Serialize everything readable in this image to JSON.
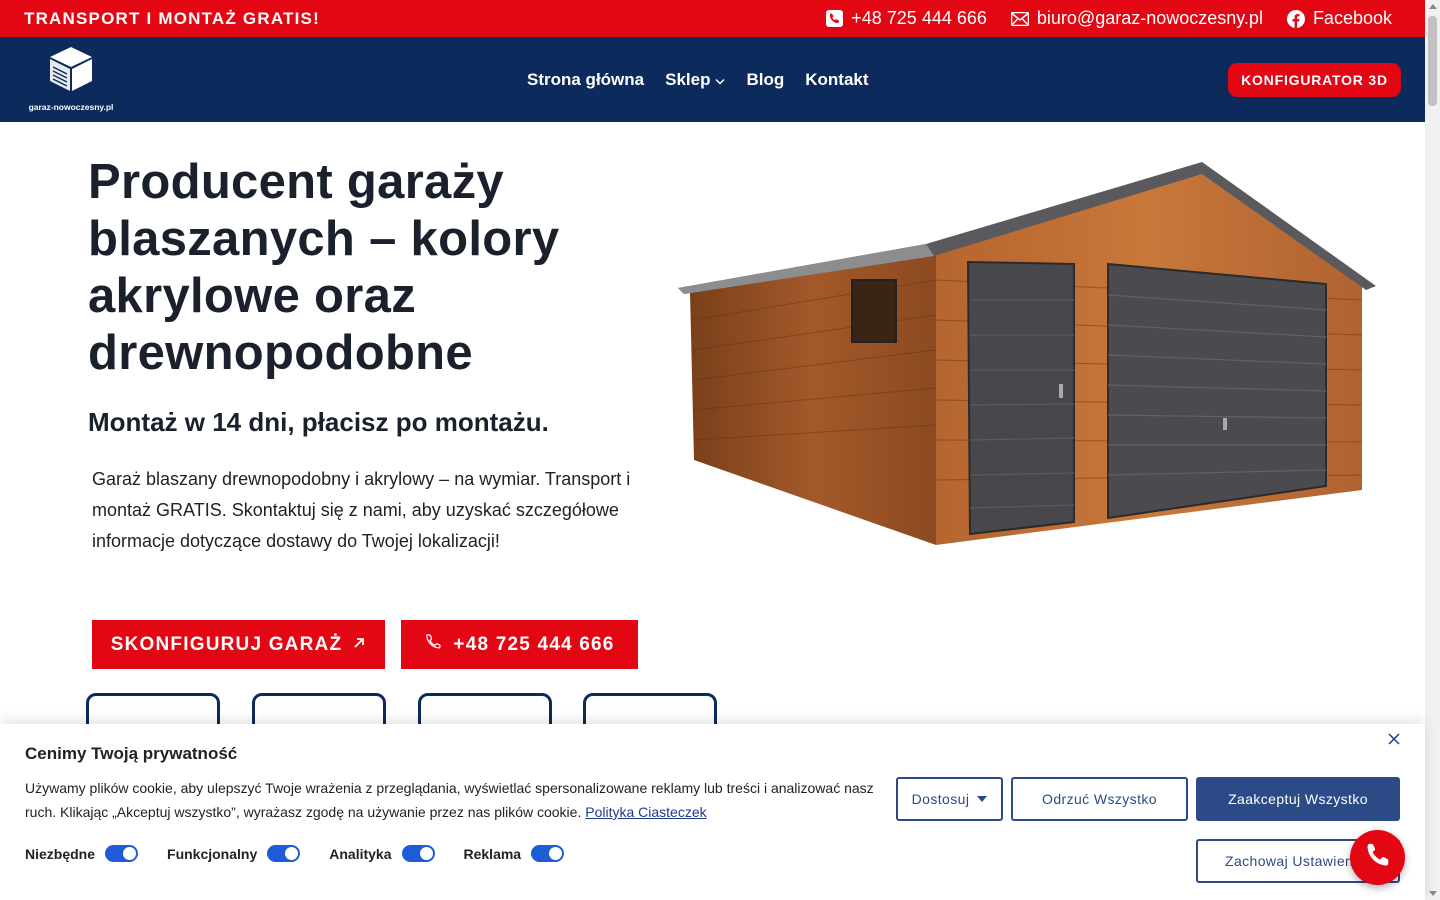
{
  "topbar": {
    "promo": "TRANSPORT I MONTAŻ GRATIS!",
    "phone": "+48 725 444 666",
    "email": "biuro@garaz-nowoczesny.pl",
    "facebook": "Facebook"
  },
  "header": {
    "logo_text": "garaz-nowoczesny.pl",
    "nav": {
      "home": "Strona główna",
      "shop": "Sklep",
      "blog": "Blog",
      "contact": "Kontakt"
    },
    "configurator_label": "KONFIGURATOR 3D"
  },
  "hero": {
    "title": "Producent garaży blaszanych – kolory akrylowe oraz drewnopodobne",
    "subtitle": "Montaż w 14 dni, płacisz po montażu.",
    "description": "Garaż blaszany drewnopodobny i akrylowy – na wymiar. Transport i montaż GRATIS. Skontaktuj się z nami, aby uzyskać szczegółowe informacje dotyczące dostawy do Twojej lokalizacji!",
    "configure_button": "SKONFIGURUJ GARAŻ",
    "phone_button": "+48 725 444 666"
  },
  "cookie": {
    "title": "Cenimy Twoją prywatność",
    "text": "Używamy plików cookie, aby ulepszyć Twoje wrażenia z przeglądania, wyświetlać spersonalizowane reklamy lub treści i analizować nasz ruch. Klikając „Akceptuj wszystko”, wyrażasz zgodę na używanie przez nas plików cookie.",
    "policy_link": "Polityka Ciasteczek",
    "toggles": [
      {
        "label": "Niezbędne",
        "on": true
      },
      {
        "label": "Funkcjonalny",
        "on": true
      },
      {
        "label": "Analityka",
        "on": true
      },
      {
        "label": "Reklama",
        "on": true
      }
    ],
    "customize": "Dostosuj",
    "reject_all": "Odrzuć Wszystko",
    "accept_all": "Zaakceptuj Wszystko",
    "save_settings": "Zachowaj Ustawienia"
  },
  "colors": {
    "brand_red": "#e30613",
    "header_navy": "#0c2a5b",
    "cookie_blue": "#2c4a86",
    "toggle_blue": "#1e5bd6"
  },
  "icons": {
    "phone": "phone-icon",
    "email": "email-icon",
    "facebook": "facebook-icon",
    "arrow": "arrow-up-right-icon",
    "close": "close-icon",
    "chevron": "chevron-down-icon"
  }
}
